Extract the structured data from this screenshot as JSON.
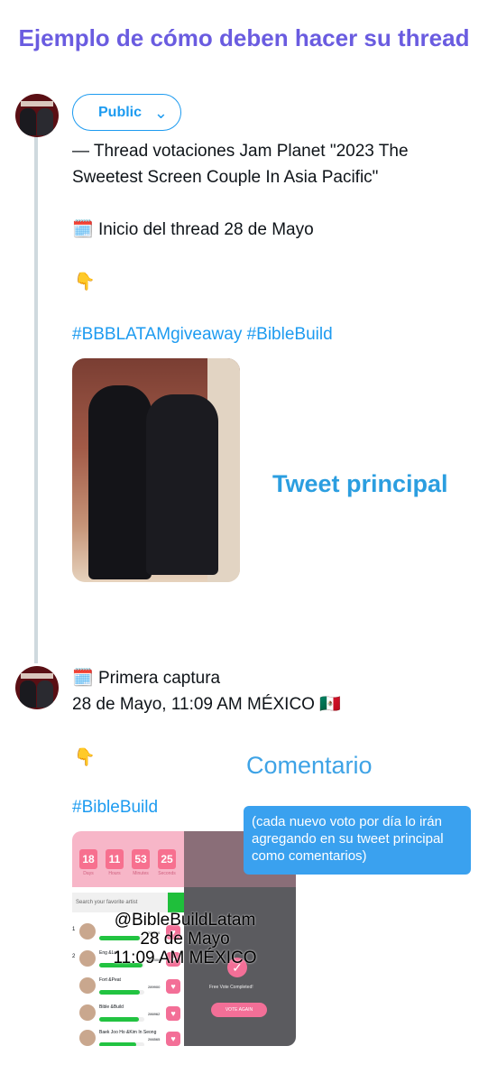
{
  "header": {
    "title": "Ejemplo de cómo deben hacer su thread"
  },
  "audience": {
    "label": "Public"
  },
  "tweet1": {
    "line1": "— Thread votaciones Jam Planet \"2023 The Sweetest Screen Couple In Asia Pacific\"",
    "line2": "Inicio del thread 28 de Mayo",
    "hashtags": "#BBBLATAMgiveaway #BibleBuild",
    "calendar_emoji": "🗓️",
    "point_emoji": "👇"
  },
  "annotations": {
    "main": "Tweet principal",
    "comment": "Comentario",
    "bubble": "(cada nuevo voto por día lo irán agregando en su tweet principal como comentarios)"
  },
  "tweet2": {
    "line1": "Primera captura",
    "line2": "28 de Mayo, 11:09 AM MÉXICO 🇲🇽",
    "hashtags": "#BibleBuild",
    "calendar_emoji": "🗓️",
    "point_emoji": "👇"
  },
  "capture": {
    "overlay_line1": "@BibleBuildLatam",
    "overlay_line2": "28 de Mayo",
    "overlay_line3": "11:09 AM MÉXICO",
    "countdown": [
      "18",
      "11",
      "53",
      "25"
    ],
    "countdown_labels": [
      "Days",
      "Hours",
      "Minutes",
      "Seconds"
    ],
    "search_placeholder": "Search your favorite artist",
    "free_vote": "Free Vote Completed!",
    "vote_again": "VOTE AGAIN",
    "rows": [
      {
        "num": "1",
        "name": "",
        "votes": "289016",
        "fill": 0.9
      },
      {
        "num": "2",
        "name": "Eng &Lot",
        "votes": "341506",
        "fill": 0.95
      },
      {
        "num": "",
        "name": "Fort &Peat",
        "votes": "289900",
        "fill": 0.9
      },
      {
        "num": "",
        "name": "Bible &Build",
        "votes": "286962",
        "fill": 0.88
      },
      {
        "num": "",
        "name": "Baek Joo Ho &Kim In Seong",
        "votes": "266565",
        "fill": 0.82
      }
    ]
  },
  "colors": {
    "title": "#6a5ce0",
    "link": "#1d9bf0",
    "bubble": "#3aa1ef"
  }
}
